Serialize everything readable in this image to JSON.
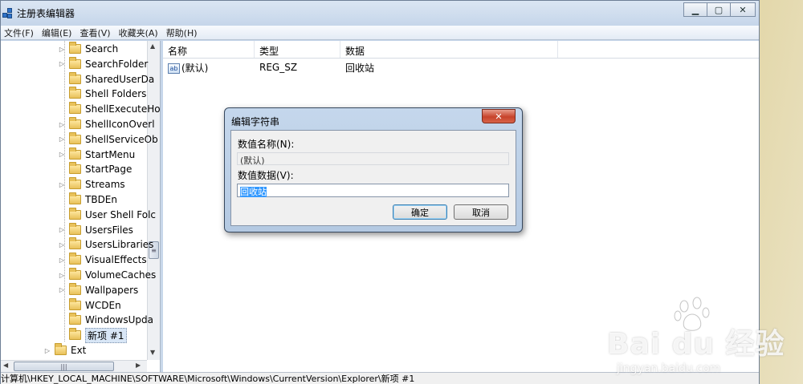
{
  "window": {
    "title": "注册表编辑器",
    "controls": {
      "minimize": "▁",
      "maximize": "▢",
      "close": "✕"
    }
  },
  "menu": [
    "文件(F)",
    "编辑(E)",
    "查看(V)",
    "收藏夹(A)",
    "帮助(H)"
  ],
  "tree": {
    "items": [
      {
        "label": "Search",
        "expandable": true
      },
      {
        "label": "SearchFolder",
        "expandable": true
      },
      {
        "label": "SharedUserDa",
        "expandable": false
      },
      {
        "label": "Shell Folders",
        "expandable": false
      },
      {
        "label": "ShellExecuteHo",
        "expandable": false
      },
      {
        "label": "ShellIconOverl",
        "expandable": true
      },
      {
        "label": "ShellServiceOb",
        "expandable": true
      },
      {
        "label": "StartMenu",
        "expandable": true
      },
      {
        "label": "StartPage",
        "expandable": false
      },
      {
        "label": "Streams",
        "expandable": true
      },
      {
        "label": "TBDEn",
        "expandable": false
      },
      {
        "label": "User Shell Folc",
        "expandable": false
      },
      {
        "label": "UsersFiles",
        "expandable": true
      },
      {
        "label": "UsersLibraries",
        "expandable": true
      },
      {
        "label": "VisualEffects",
        "expandable": true
      },
      {
        "label": "VolumeCaches",
        "expandable": true
      },
      {
        "label": "Wallpapers",
        "expandable": true
      },
      {
        "label": "WCDEn",
        "expandable": false
      },
      {
        "label": "WindowsUpda",
        "expandable": false
      },
      {
        "label": "新项 #1",
        "expandable": false,
        "selected": true
      }
    ],
    "parent": {
      "label": "Ext",
      "expandable": true
    }
  },
  "list": {
    "columns": [
      "名称",
      "类型",
      "数据"
    ],
    "rows": [
      {
        "name": "(默认)",
        "type": "REG_SZ",
        "data": "回收站",
        "icon": "ab"
      }
    ]
  },
  "status": "计算机\\HKEY_LOCAL_MACHINE\\SOFTWARE\\Microsoft\\Windows\\CurrentVersion\\Explorer\\新项 #1",
  "dialog": {
    "title": "编辑字符串",
    "close": "✕",
    "name_label": "数值名称(N):",
    "name_value": "(默认)",
    "data_label": "数值数据(V):",
    "data_value": "回收站",
    "ok": "确定",
    "cancel": "取消"
  },
  "watermark": {
    "brand": "Bai du 经验",
    "url": "jingyan.baidu.com"
  }
}
